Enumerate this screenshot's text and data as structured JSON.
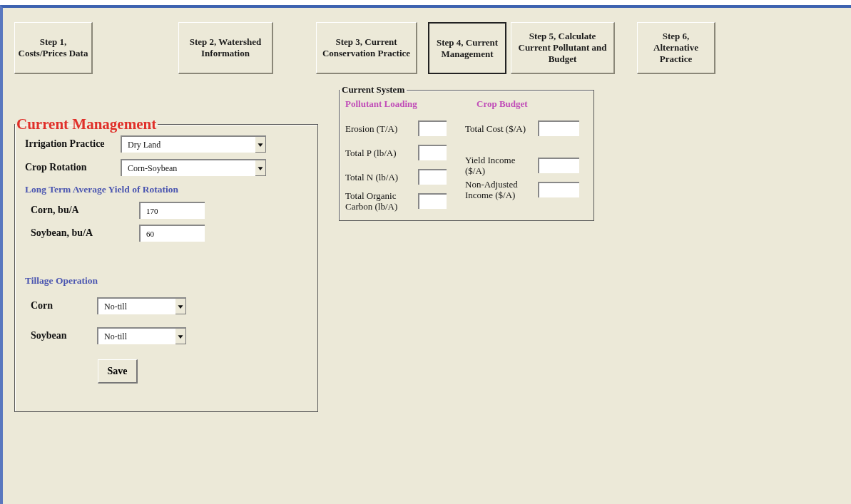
{
  "steps": [
    {
      "label": "Step 1, Costs/Prices Data",
      "selected": false
    },
    {
      "label": "Step 2, Watershed Information",
      "selected": false
    },
    {
      "label": "Step 3, Current Conservation Practice",
      "selected": false
    },
    {
      "label": "Step 4, Current Management",
      "selected": true
    },
    {
      "label": "Step 5, Calculate Current Pollutant and Budget",
      "selected": false
    },
    {
      "label": "Step 6, Alternative Practice",
      "selected": false
    }
  ],
  "current_management": {
    "title": "Current Management",
    "selects": [
      {
        "label": "Irrigation Practice",
        "value": "Dry Land"
      },
      {
        "label": "Crop Rotation",
        "value": "Corn-Soybean"
      }
    ],
    "yield_heading": "Long Term Average Yield of Rotation",
    "yields": [
      {
        "label": "Corn, bu/A",
        "value": "170"
      },
      {
        "label": "Soybean, bu/A",
        "value": "60"
      }
    ],
    "tillage_heading": "Tillage Operation",
    "tillage": [
      {
        "label": "Corn",
        "value": "No-till"
      },
      {
        "label": "Soybean",
        "value": "No-till"
      }
    ],
    "save_button": "Save"
  },
  "current_system": {
    "title": "Current System",
    "pollutant_heading": "Pollutant Loading",
    "pollutant_fields": [
      {
        "label": "Erosion (T/A)"
      },
      {
        "label": "Total P (lb/A)"
      },
      {
        "label": "Total N (lb/A)"
      },
      {
        "label": "Total Organic Carbon (lb/A)"
      }
    ],
    "budget_heading": "Crop Budget",
    "budget_fields": [
      {
        "label": "Total Cost ($/A)"
      },
      {
        "label": "Yield Income ($/A)"
      },
      {
        "label": "Non-Adjusted Income ($/A)"
      }
    ]
  }
}
